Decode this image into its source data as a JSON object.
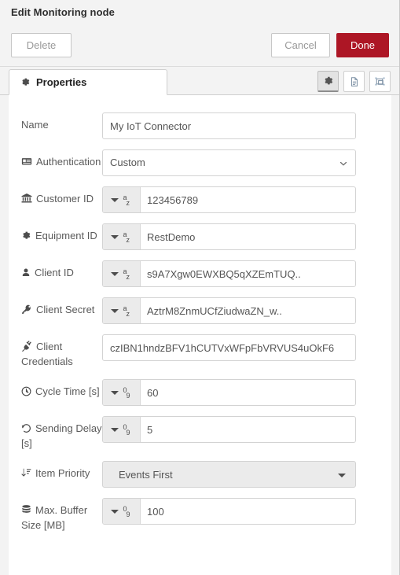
{
  "dialog": {
    "title": "Edit Monitoring node"
  },
  "toolbar": {
    "delete_label": "Delete",
    "cancel_label": "Cancel",
    "done_label": "Done",
    "done_color": "#ad1625"
  },
  "tabs": {
    "active": "Properties",
    "items": [
      {
        "label": "Properties",
        "icon": "gear-icon"
      }
    ],
    "icon_buttons": [
      {
        "name": "properties-view-button",
        "icon": "gear-icon",
        "active": true
      },
      {
        "name": "description-view-button",
        "icon": "document-icon",
        "active": false
      },
      {
        "name": "appearance-view-button",
        "icon": "node-appearance-icon",
        "active": false
      }
    ]
  },
  "form": {
    "fields": [
      {
        "key": "name",
        "label": "Name",
        "icon": null,
        "control": "text",
        "value": "My IoT Connector",
        "placeholder": "Name"
      },
      {
        "key": "authentication",
        "label": "Authentication",
        "icon": "id-card-icon",
        "control": "select",
        "value": "Custom",
        "options": [
          "Custom"
        ]
      },
      {
        "key": "customer_id",
        "label": "Customer ID",
        "icon": "bank-icon",
        "control": "typed",
        "type": "str",
        "value": "123456789"
      },
      {
        "key": "equipment_id",
        "label": "Equipment ID",
        "icon": "gear-icon",
        "control": "typed",
        "type": "str",
        "value": "RestDemo"
      },
      {
        "key": "client_id",
        "label": "Client ID",
        "icon": "user-icon",
        "control": "typed",
        "type": "str",
        "value": "s9A7Xgw0EWXBQ5qXZEmTUQ.."
      },
      {
        "key": "client_secret",
        "label": "Client Secret",
        "icon": "key-icon",
        "control": "typed",
        "type": "str",
        "value": "AztrM8ZnmUCfZiudwaZN_w.."
      },
      {
        "key": "client_credentials",
        "label": "Client Credentials",
        "icon": "plug-icon",
        "control": "text",
        "value": "czIBN1hndzBFV1hCUTVxWFpFbVRVUS4uOkF6",
        "placeholder": "Client Credentials"
      },
      {
        "key": "cycle_time",
        "label": "Cycle Time [s]",
        "icon": "clock-icon",
        "control": "typed",
        "type": "num",
        "value": "60"
      },
      {
        "key": "sending_delay",
        "label": "Sending Delay [s]",
        "icon": "history-icon",
        "control": "typed",
        "type": "num",
        "value": "5"
      },
      {
        "key": "item_priority",
        "label": "Item Priority",
        "icon": "sort-numeric-icon",
        "control": "select-gray",
        "value": "Events First",
        "options": [
          "Events First"
        ]
      },
      {
        "key": "max_buffer_size",
        "label": "Max. Buffer Size [MB]",
        "icon": "database-icon",
        "control": "typed",
        "type": "num",
        "value": "100"
      }
    ]
  }
}
